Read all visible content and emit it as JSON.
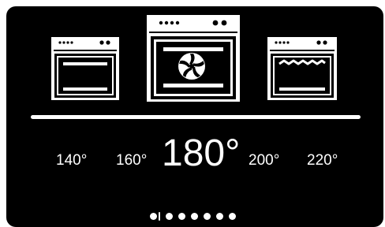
{
  "modes": [
    {
      "name": "conventional-bake",
      "icon": "oven-conventional-icon",
      "selected": false
    },
    {
      "name": "fan-bake",
      "icon": "oven-fan-icon",
      "selected": true
    },
    {
      "name": "grill",
      "icon": "oven-grill-icon",
      "selected": false
    }
  ],
  "temperatures": {
    "t140": "140°",
    "t160": "160°",
    "t180": "180°",
    "t200": "200°",
    "t220": "220°",
    "selected": "180°"
  },
  "pager": {
    "page_count": 7,
    "current_page": 1
  },
  "colors": {
    "background": "#000000",
    "foreground": "#ffffff"
  }
}
